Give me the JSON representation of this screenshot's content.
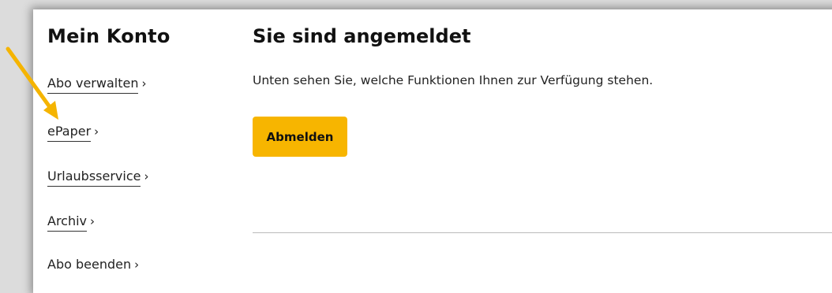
{
  "sidebar": {
    "title": "Mein Konto",
    "items": [
      {
        "label": "Abo verwalten",
        "chevron": "›"
      },
      {
        "label": "ePaper",
        "chevron": "›"
      },
      {
        "label": "Urlaubsservice",
        "chevron": "›"
      },
      {
        "label": "Archiv",
        "chevron": "›"
      },
      {
        "label": "Abo beenden",
        "chevron": "›"
      }
    ]
  },
  "main": {
    "title": "Sie sind angemeldet",
    "subtitle": "Unten sehen Sie, welche Funktionen Ihnen zur Verfügung stehen.",
    "logout_label": "Abmelden"
  },
  "colors": {
    "button_accent": "#f7b500",
    "annotation_arrow": "#f5b400"
  },
  "annotation": {
    "icon": "arrow-icon",
    "points_to": "ePaper"
  }
}
